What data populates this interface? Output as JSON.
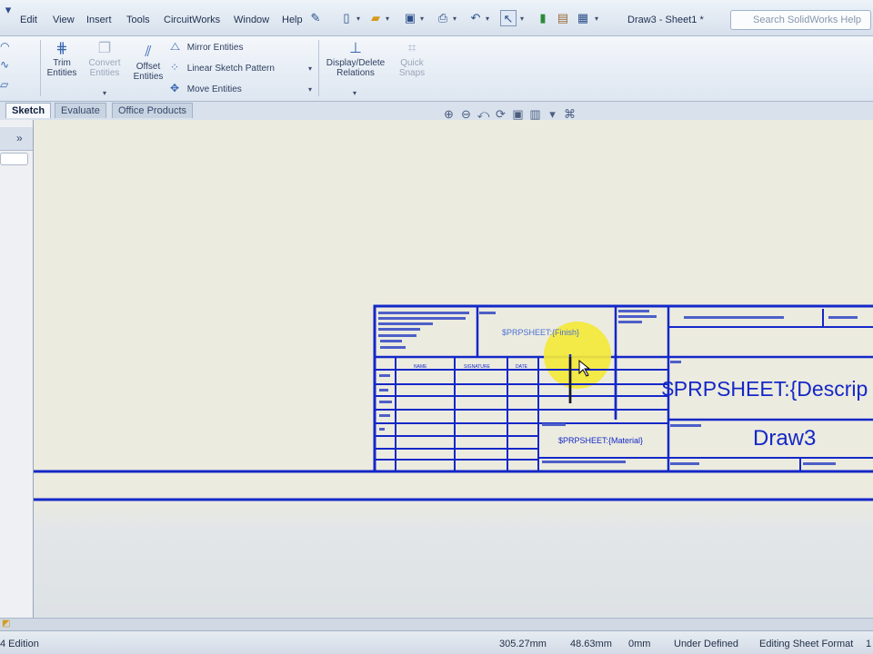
{
  "menu": {
    "items": [
      "Edit",
      "View",
      "Insert",
      "Tools",
      "CircuitWorks",
      "Window",
      "Help"
    ]
  },
  "title": "Draw3 - Sheet1 *",
  "search": {
    "placeholder": "Search SolidWorks Help"
  },
  "ribbon": {
    "trim": "Trim\nEntities",
    "convert": "Convert\nEntities",
    "offset": "Offset\nEntities",
    "mirror": "Mirror Entities",
    "linear_pattern": "Linear Sketch Pattern",
    "move": "Move Entities",
    "relations": "Display/Delete\nRelations",
    "quick_snaps": "Quick\nSnaps"
  },
  "tabs": [
    "Sketch",
    "Evaluate",
    "Office Products"
  ],
  "active_tab": "Sketch",
  "title_block": {
    "finish": "$PRPSHEET:{Finish}",
    "material": "$PRPSHEET:{Material}",
    "description": "$PRPSHEET:{Descrip",
    "drawing_name": "Draw3",
    "headers": [
      "NAME",
      "SIGNATURE",
      "DATE"
    ]
  },
  "status": {
    "edition": "4 Edition",
    "x": "305.27mm",
    "y": "48.63mm",
    "z": "0mm",
    "state": "Under Defined",
    "mode": "Editing Sheet Format",
    "sheet": "1"
  },
  "colors": {
    "sheet_border": "#1428c8",
    "highlight": "#f3e83a"
  }
}
